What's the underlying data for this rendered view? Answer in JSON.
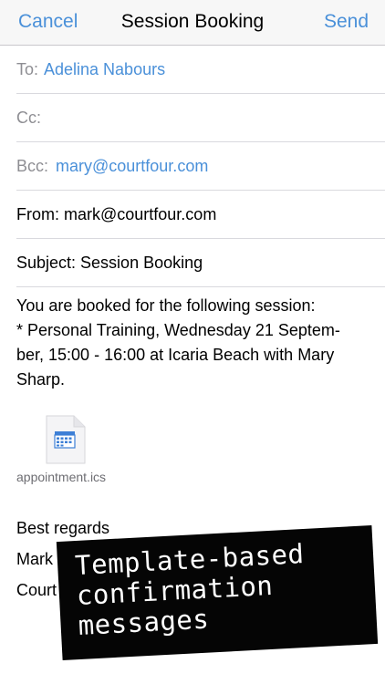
{
  "navbar": {
    "cancel_label": "Cancel",
    "title": "Session Booking",
    "send_label": "Send"
  },
  "fields": {
    "to_label": "To:",
    "to_value": "Adelina Nabours",
    "cc_label": "Cc:",
    "bcc_label": "Bcc:",
    "bcc_value": "mary@courtfour.com",
    "from_text": "From: mark@courtfour.com",
    "subject_text": "Subject: Session Booking"
  },
  "body": {
    "lines": [
      "You are booked for the following session:",
      "* Personal Training, Wednesday 21 Septem-",
      "ber, 15:00 - 16:00 at Icaria Beach with Mary",
      "Sharp."
    ]
  },
  "attachment": {
    "filename": "appointment.ics",
    "icon": "calendar-document-icon"
  },
  "signature": {
    "regards": "Best regards",
    "name": "Mark",
    "company_partial": "Court"
  },
  "banner": {
    "lines": [
      "Template-based",
      "confirmation",
      "messages"
    ]
  },
  "colors": {
    "accent": "#4a90d9",
    "placeholder_gray": "#8e8e93",
    "banner_bg": "#050505",
    "banner_text": "#ffffff"
  }
}
